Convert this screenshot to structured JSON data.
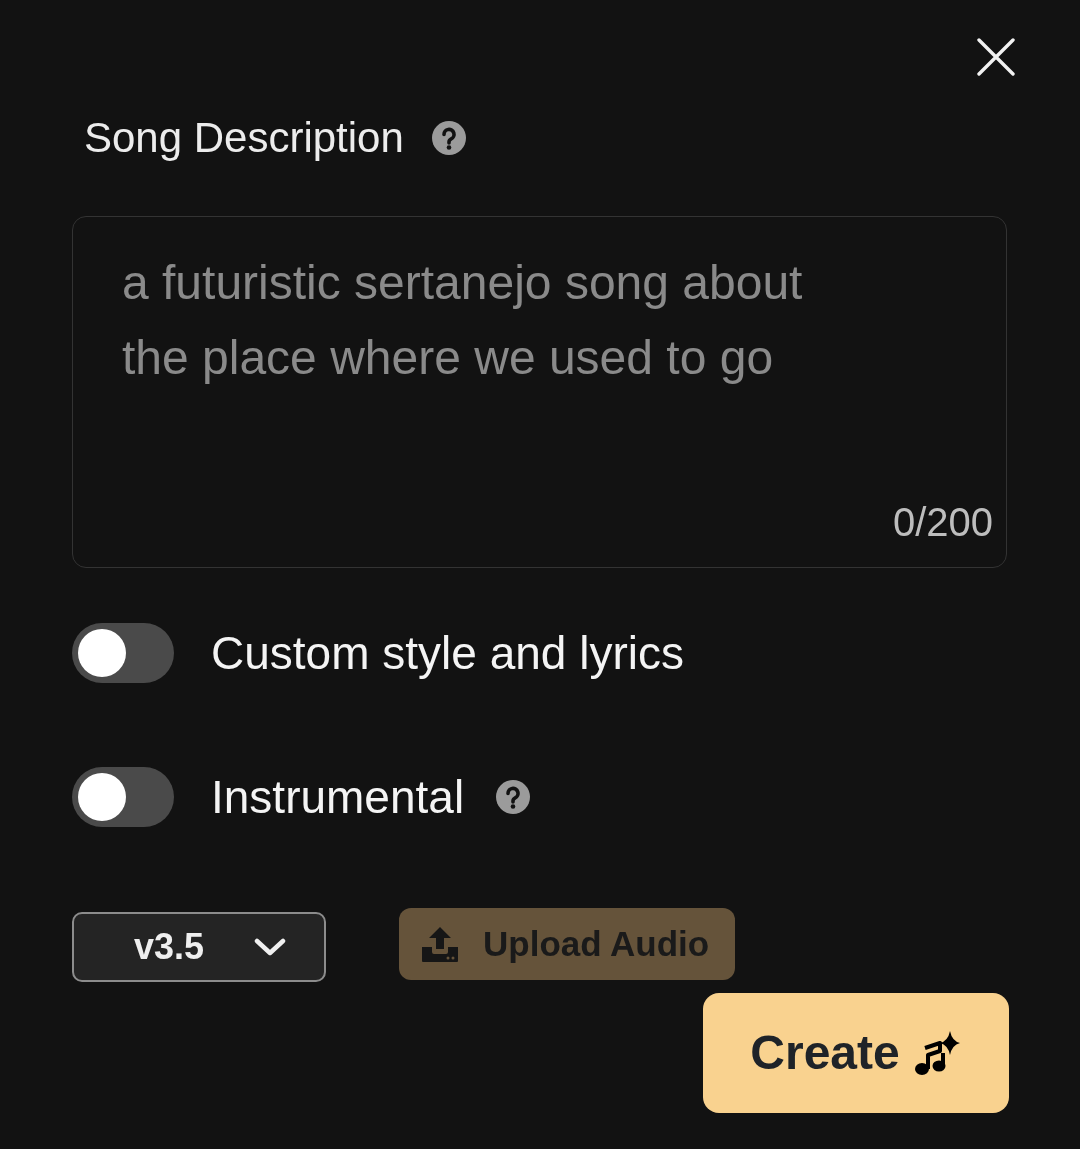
{
  "description": {
    "label": "Song Description",
    "placeholder": "a futuristic sertanejo song about the place where we used to go",
    "counter": "0/200"
  },
  "toggles": [
    {
      "label": "Custom style and lyrics",
      "on": false,
      "help": false
    },
    {
      "label": "Instrumental",
      "on": false,
      "help": true
    }
  ],
  "model_select": {
    "value": "v3.5"
  },
  "upload_button": {
    "label": "Upload Audio"
  },
  "create_button": {
    "label": "Create"
  }
}
